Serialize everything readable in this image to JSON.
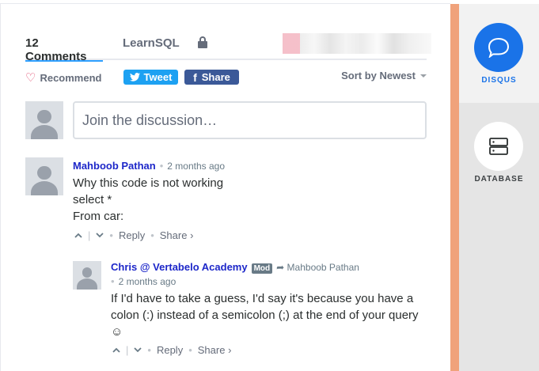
{
  "tabs": {
    "comments": "12 Comments",
    "community": "LearnSQL"
  },
  "actions": {
    "recommend": "Recommend",
    "tweet": "Tweet",
    "share": "Share",
    "sort": "Sort by Newest"
  },
  "join": {
    "placeholder": "Join the discussion…"
  },
  "comments": [
    {
      "author": "Mahboob Pathan",
      "time": "2 months ago",
      "lines": [
        "Why this code is not working",
        "select *",
        "From car:"
      ],
      "reply": "Reply",
      "share": "Share ›"
    },
    {
      "author": "Chris @ Vertabelo Academy",
      "badge": "Mod",
      "reply_to": "Mahboob Pathan",
      "time": "2 months ago",
      "text": "If I'd have to take a guess, I'd say it's because you have a colon (:) instead of a semicolon (;) at the end of your query ☺",
      "reply": "Reply",
      "share": "Share ›"
    }
  ],
  "sidebar": {
    "items": [
      {
        "label": "DISQUS",
        "icon": "disqus-icon",
        "active": true
      },
      {
        "label": "DATABASE",
        "icon": "database-icon",
        "active": false
      }
    ]
  },
  "colors": {
    "accent": "#2e9fff",
    "author": "#1d27c9",
    "tweet": "#1da1f2",
    "facebook": "#3b5998",
    "sidebar_accent": "#f0a27b"
  }
}
